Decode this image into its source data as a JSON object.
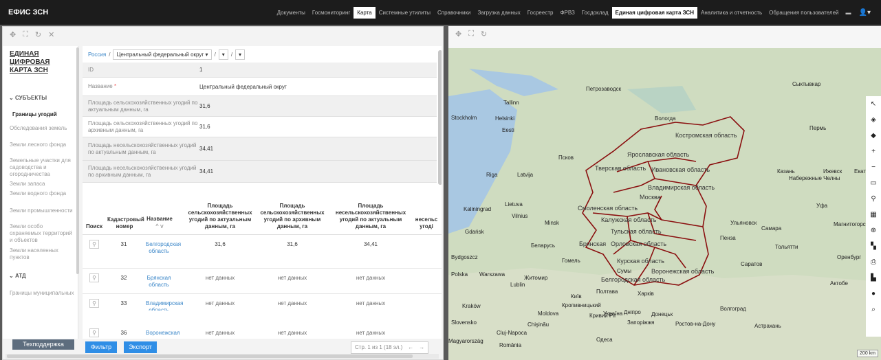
{
  "app": {
    "brand": "ЕФИС ЗСН"
  },
  "menu": [
    "Документы",
    "Госмониторинг",
    "Карта",
    "Системные утилиты",
    "Справочники",
    "Загрузка данных",
    "Госреестр",
    "ФРВЗ",
    "Госдоклад",
    "Единая цифровая карта ЗСН",
    "Аналитика и отчетность",
    "Обращения пользователей"
  ],
  "user_icon": "user-icon",
  "sidebar": {
    "title": "ЕДИНАЯ ЦИФРОВАЯ КАРТА ЗСН",
    "sections": [
      {
        "label": "СУБЪЕКТЫ",
        "items": [
          "Границы угодий",
          "Обследования земель",
          "Земли лесного фонда",
          "Земельные участки для садоводства и огородничества",
          "Земли запаса",
          "Земли водного фонда",
          "Земли промышленности",
          "Земли особо охраняемых территорий и объектов",
          "Земли населенных пунктов"
        ]
      },
      {
        "label": "АТД",
        "items": [
          "Границы муниципальных"
        ]
      }
    ],
    "support": "Техподдержка"
  },
  "breadcrumb": {
    "root": "Россия",
    "district": "Центральный федеральный округ"
  },
  "fields": [
    {
      "label": "ID",
      "value": "1"
    },
    {
      "label": "Название",
      "required": "*",
      "value": "Центральный федеральный округ"
    },
    {
      "label": "Площадь сельскохозяйственных угодий по актуальным данным, га",
      "value": "31,6"
    },
    {
      "label": "Площадь сельскохозяйственных угодий по архивным данным, га",
      "value": "31,6"
    },
    {
      "label": "Площадь несельскохозяйственных угодий по актуальным данным, га",
      "value": "34,41"
    },
    {
      "label": "Площадь несельскохозяйственных угодий по архивным данным, га",
      "value": "34,41"
    }
  ],
  "grid": {
    "headers": [
      "Поиск",
      "Кадастровый номер",
      "Название",
      "Площадь сельскохозяйственных угодий по актуальным данным, га",
      "Площадь сельскохозяйственных угодий по архивным данным, га",
      "Площадь несельскохозяйственных угодий по актуальным данным, га",
      "несельс угоді"
    ],
    "sort_arrows": "^ v",
    "rows": [
      {
        "num": "31",
        "name": "Белгородская область",
        "a": "31,6",
        "b": "31,6",
        "c": "34,41"
      },
      {
        "num": "32",
        "name": "Брянская область",
        "a": "нет данных",
        "b": "нет данных",
        "c": "нет данных"
      },
      {
        "num": "33",
        "name": "Владимирская область",
        "a": "нет данных",
        "b": "нет данных",
        "c": "нет данных"
      },
      {
        "num": "36",
        "name": "Воронежская",
        "a": "нет данных",
        "b": "нет данных",
        "c": "нет данных"
      }
    ]
  },
  "buttons": {
    "filter": "Фильтр",
    "export": "Экспорт"
  },
  "pager": {
    "text": "Стр. 1 из 1 (18 эл.)",
    "prev": "←",
    "next": "→"
  },
  "map": {
    "labels": [
      "Костромская область",
      "Ярославская область",
      "Тверская область",
      "Ивановская область",
      "Владимирская область",
      "Москва",
      "Смоленская область",
      "Калужская область",
      "Тульская область",
      "Брянская",
      "Орловская область",
      "Курская область",
      "Воронежская область",
      "Белгородская область"
    ],
    "places": [
      "Петрозаводск",
      "Сыктывкар",
      "Helsinki",
      "Stockholm",
      "Eesti",
      "Latvija",
      "Lietuva",
      "Vilnius",
      "Беларусь",
      "Gdańsk",
      "Polska",
      "Warszawa",
      "Bydgoszcz",
      "Lublin",
      "Kraków",
      "Україна",
      "Київ",
      "Харків",
      "Донецьк",
      "Ростов-на-Дону",
      "Волгоград",
      "Самара",
      "Пермь",
      "Казань",
      "Ижевск",
      "Оренбург",
      "Уфа",
      "Астрахань",
      "Chişinău",
      "Moldova",
      "România",
      "Slovensko",
      "Magyarország",
      "Cluj-Napoca",
      "Minsk",
      "Вологда",
      "Псков",
      "Ульяновск",
      "Саратов",
      "Набережные Челны",
      "Kaliningrad",
      "Екатеринбург",
      "Актобе",
      "Riga",
      "Tallinn",
      "Гомель",
      "Житомир",
      "Одеса",
      "Запоріжжя",
      "Дніпро",
      "Кропивницький",
      "Кривий Ріг",
      "Полтава",
      "Сумы",
      "Пенза",
      "Тольятти",
      "Магнитогорск"
    ],
    "scale": "200 km"
  }
}
